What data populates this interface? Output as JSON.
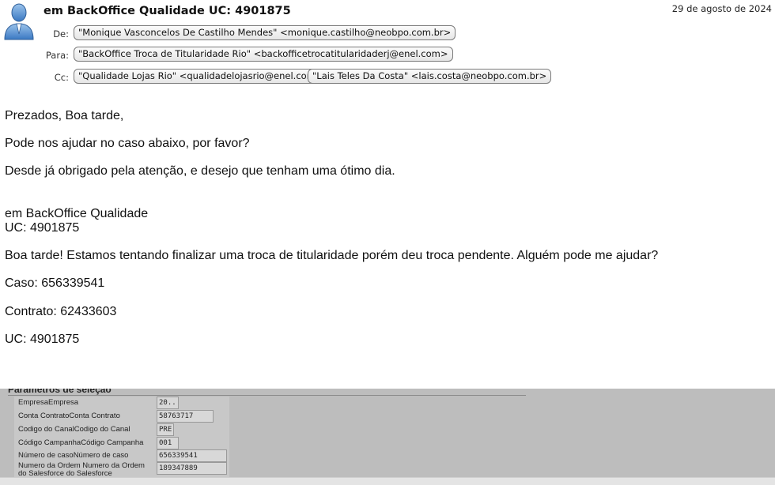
{
  "email": {
    "subject": "em BackOffice Qualidade UC: 4901875",
    "date": "29 de agosto de 2024",
    "from_label": "De:",
    "to_label": "Para:",
    "cc_label": "Cc:",
    "from": "\"Monique Vasconcelos De Castilho Mendes\" <monique.castilho@neobpo.com.br>",
    "to": "\"BackOffice Troca de Titularidade Rio\" <backofficetrocatitularidaderj@enel.com>",
    "cc": [
      "\"Qualidade Lojas Rio\" <qualidadelojasrio@enel.com>",
      "\"Lais Teles Da Costa\" <lais.costa@neobpo.com.br>"
    ]
  },
  "body": {
    "greeting": "Prezados, Boa tarde,",
    "request": "Pode nos ajudar no caso abaixo, por favor?",
    "thanks": "Desde já obrigado pela atenção, e desejo que tenham uma ótimo dia.",
    "quote_title": "em BackOffice Qualidade",
    "quote_uc": "UC: 4901875",
    "message": "Boa tarde! Estamos tentando finalizar uma troca de titularidade porém deu troca pendente. Alguém pode me ajudar?",
    "caso": "Caso: 656339541",
    "contrato": "Contrato: 62433603",
    "uc": "UC: 4901875"
  },
  "screenshot_panel": {
    "title": "Parâmetros de seleção",
    "rows": [
      {
        "label": "EmpresaEmpresa",
        "value": "20.."
      },
      {
        "label": "Conta ContratoConta Contrato",
        "value": "58763717"
      },
      {
        "label": "Codigo do CanalCodigo do Canal",
        "value": "PRE"
      },
      {
        "label": "Código CampanhaCódigo Campanha",
        "value": "001"
      },
      {
        "label": "Número de casoNúmero de caso",
        "value": "656339541"
      },
      {
        "label": "Numero da Ordem   Numero da Ordem",
        "label2": "do Salesforce        do Salesforce",
        "value": "189347889"
      }
    ]
  },
  "icons": {
    "avatar": "user-avatar-icon"
  },
  "colors": {
    "chip_border": "#7a7a7a",
    "panel_bg": "#bdbdbd"
  }
}
